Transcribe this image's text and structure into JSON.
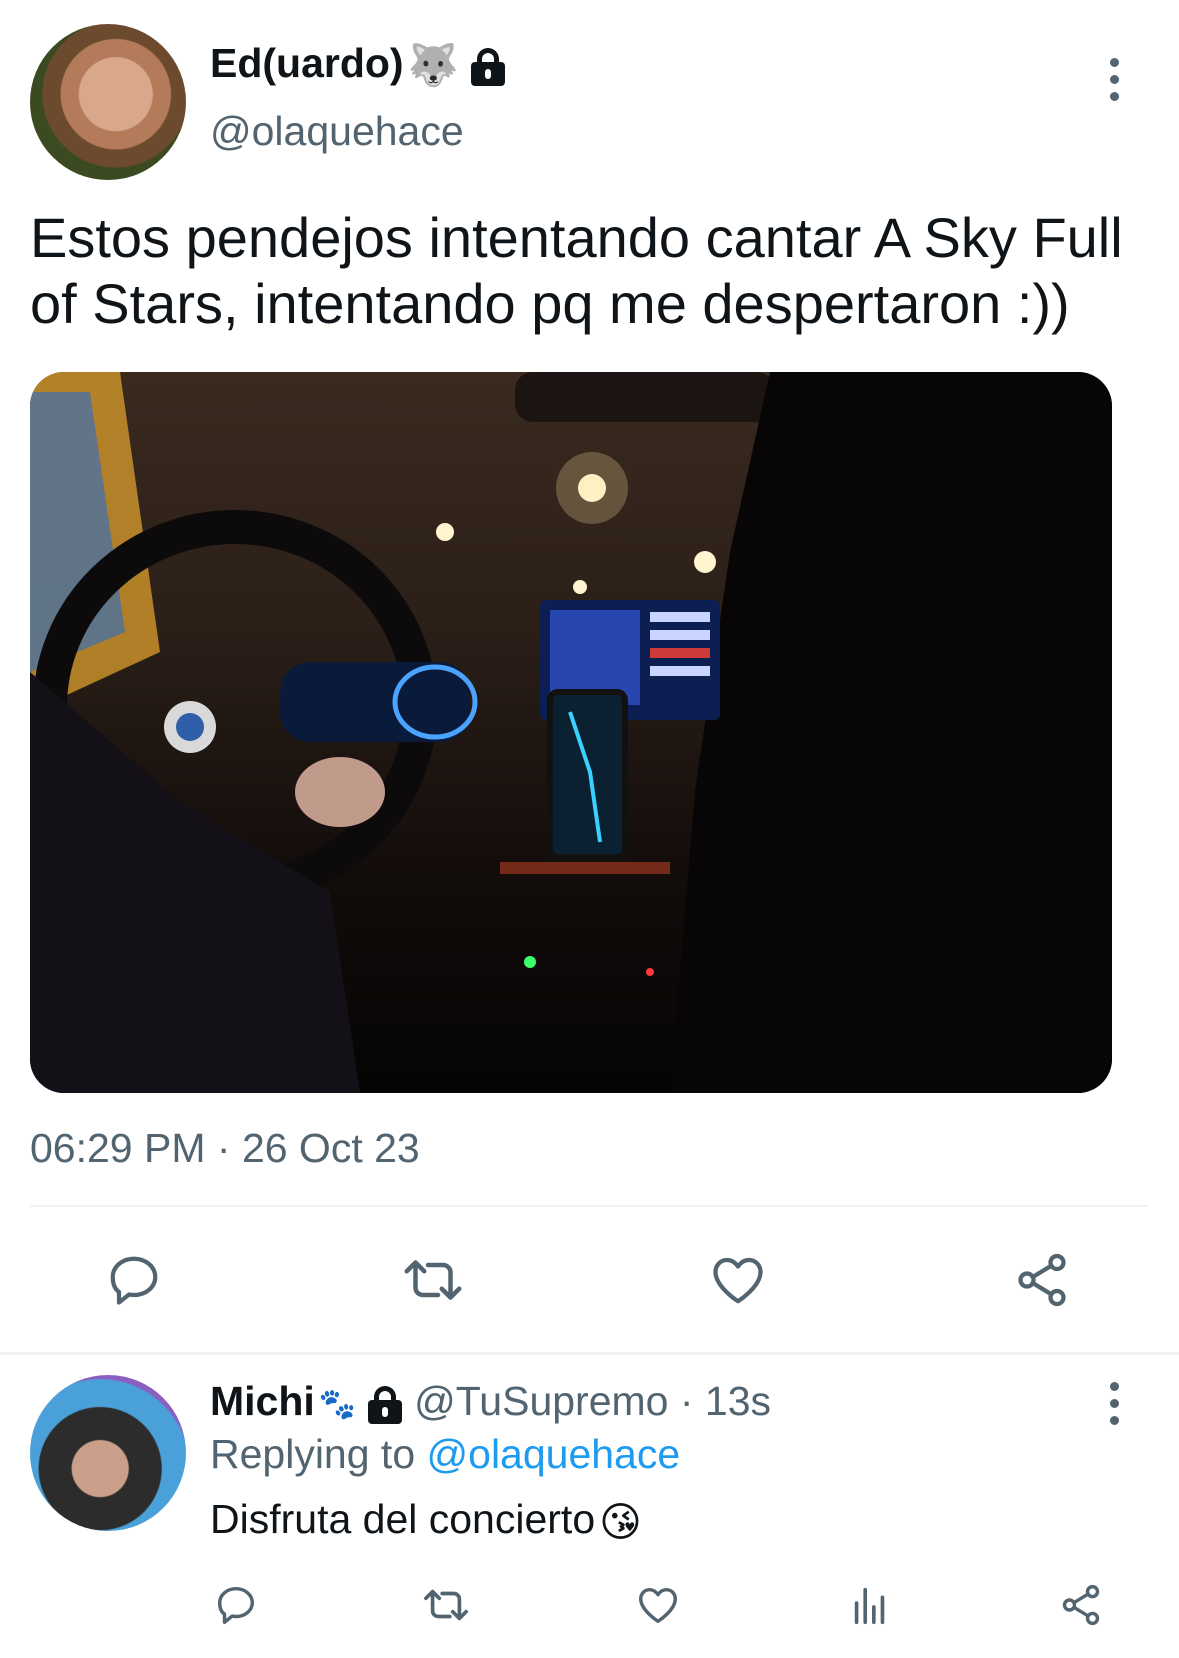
{
  "tweet": {
    "author_name": "Ed(uardo)",
    "author_emoji": "🐺",
    "handle": "@olaquehace",
    "text": "Estos pendejos intentando cantar A Sky Full of Stars, intentando pq me despertaron :))",
    "time": "06:29 PM",
    "separator": " · ",
    "date": "26 Oct 23",
    "media_description": "photo"
  },
  "reply": {
    "author_name": "Michi",
    "author_emoji": "🐾",
    "handle": "@TuSupremo",
    "separator": " · ",
    "time": "13s",
    "replying_prefix": "Replying to ",
    "replying_to": "@olaquehace",
    "text": "Disfruta del concierto",
    "text_emoji": "😘"
  },
  "icons": {
    "reply": "reply-icon",
    "retweet": "retweet-icon",
    "like": "like-icon",
    "share": "share-icon",
    "views": "views-icon",
    "more": "more-icon",
    "lock": "lock-icon"
  },
  "colors": {
    "text": "#0f1419",
    "secondary": "#536471",
    "link": "#1d9bf0",
    "divider": "#eff3f4"
  }
}
